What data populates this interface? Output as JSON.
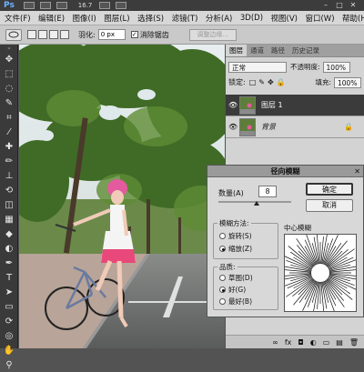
{
  "app": {
    "logo": "Ps",
    "zoom": "16.7"
  },
  "menu": [
    "文件(F)",
    "编辑(E)",
    "图像(I)",
    "图层(L)",
    "选择(S)",
    "滤镜(T)",
    "分析(A)",
    "3D(D)",
    "视图(V)",
    "窗口(W)",
    "帮助(H)"
  ],
  "options": {
    "feather_label": "羽化:",
    "feather_value": "0 px",
    "antialias_label": "消除锯齿",
    "antialias_check": "✓",
    "refine_edge": "调整边缘..."
  },
  "layers_panel": {
    "tabs": [
      "图层",
      "通道",
      "路径",
      "历史记录"
    ],
    "blend_mode": "正常",
    "opacity_label": "不透明度:",
    "opacity": "100%",
    "lock_label": "锁定:",
    "fill_label": "填充:",
    "fill": "100%",
    "layers": [
      {
        "name": "图层 1",
        "selected": true
      },
      {
        "name": "背景",
        "selected": false
      }
    ],
    "bottom_icons": [
      "∞",
      "fx",
      "◘",
      "◐",
      "▭",
      "▤",
      "🗑"
    ]
  },
  "dialog": {
    "title": "径向模糊",
    "amount_label": "数量(A)",
    "amount_value": "8",
    "ok": "确定",
    "cancel": "取消",
    "method_label": "模糊方法:",
    "method_spin": "旋转(S)",
    "method_zoom": "缩放(Z)",
    "method_selected": "缩放(Z)",
    "quality_label": "品质:",
    "quality_draft": "草图(D)",
    "quality_good": "好(G)",
    "quality_best": "最好(B)",
    "quality_selected": "好(G)",
    "center_label": "中心模糊"
  }
}
